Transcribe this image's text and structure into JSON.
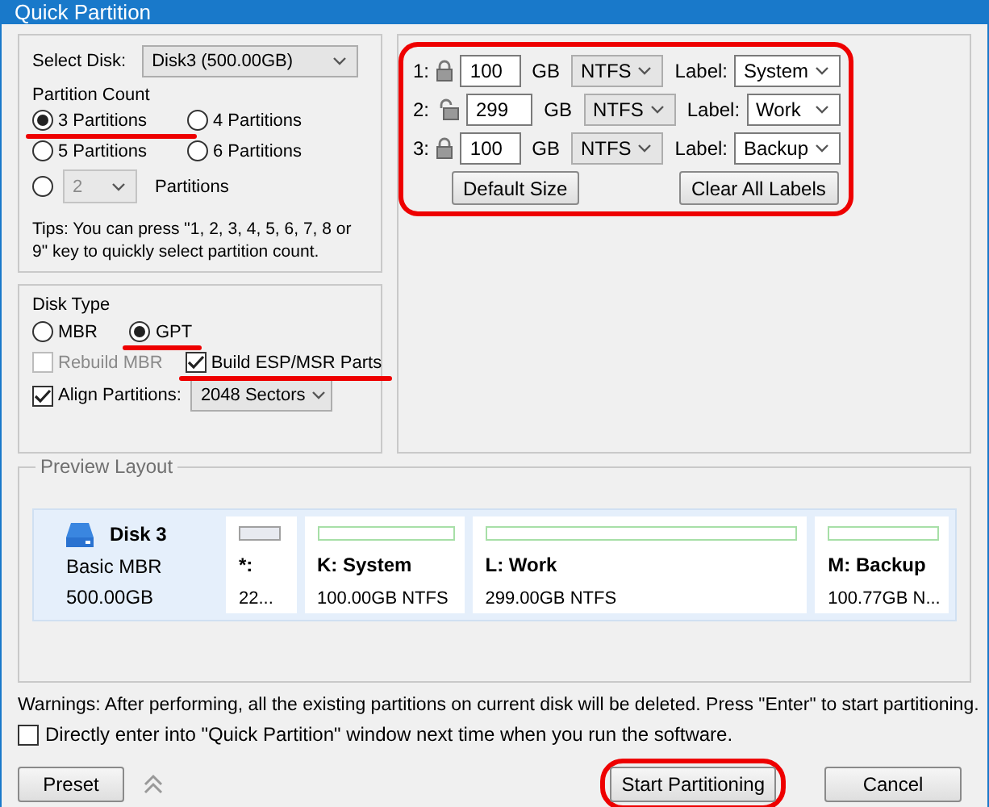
{
  "window": {
    "title": "Quick Partition"
  },
  "disk_select": {
    "label": "Select Disk:",
    "value": "Disk3 (500.00GB)"
  },
  "partition_count": {
    "title": "Partition Count",
    "options": [
      {
        "label": "3 Partitions",
        "selected": true,
        "marked": true
      },
      {
        "label": "4 Partitions",
        "selected": false,
        "marked": false
      },
      {
        "label": "5 Partitions",
        "selected": false,
        "marked": false
      },
      {
        "label": "6 Partitions",
        "selected": false,
        "marked": false
      }
    ],
    "custom": {
      "value": "2",
      "label": "Partitions",
      "selected": false,
      "disabled": true
    },
    "tips": "Tips: You can press \"1, 2, 3, 4, 5, 6, 7, 8 or 9\" key to quickly select partition count."
  },
  "disk_type": {
    "title": "Disk Type",
    "options": [
      {
        "label": "MBR",
        "selected": false,
        "marked": false
      },
      {
        "label": "GPT",
        "selected": true,
        "marked": true
      }
    ],
    "checkboxes": [
      {
        "label": "Rebuild MBR",
        "checked": false,
        "disabled": true,
        "marked": false
      },
      {
        "label": "Build ESP/MSR Parts",
        "checked": true,
        "disabled": false,
        "marked": true
      }
    ],
    "align": {
      "label": "Align Partitions:",
      "checked": true,
      "value": "2048 Sectors"
    }
  },
  "partitions": {
    "marked": true,
    "rows": [
      {
        "index": "1:",
        "locked": true,
        "size": "100",
        "unit": "GB",
        "fs": "NTFS",
        "label_caption": "Label:",
        "label": "System"
      },
      {
        "index": "2:",
        "locked": false,
        "size": "299",
        "unit": "GB",
        "fs": "NTFS",
        "label_caption": "Label:",
        "label": "Work"
      },
      {
        "index": "3:",
        "locked": true,
        "size": "100",
        "unit": "GB",
        "fs": "NTFS",
        "label_caption": "Label:",
        "label": "Backup"
      }
    ],
    "buttons": [
      "Default Size",
      "Clear All Labels"
    ]
  },
  "preview": {
    "title": "Preview Layout",
    "disk": {
      "name": "Disk 3",
      "type": "Basic MBR",
      "size": "500.00GB"
    },
    "parts": [
      {
        "kind": "unallocated",
        "name": "*:",
        "info": "22..."
      },
      {
        "kind": "ntfs",
        "name": "K: System",
        "info": "100.00GB NTFS"
      },
      {
        "kind": "ntfs",
        "name": "L: Work",
        "info": "299.00GB NTFS"
      },
      {
        "kind": "ntfs",
        "name": "M: Backup",
        "info": "100.77GB N..."
      }
    ]
  },
  "warning": "Warnings: After performing, all the existing partitions on current disk will be deleted. Press \"Enter\" to start partitioning.",
  "startup_checkbox": {
    "label": "Directly enter into \"Quick Partition\" window next time when you run the software.",
    "checked": false
  },
  "buttons": [
    {
      "kind": "preset",
      "label": "Preset",
      "marked": false
    },
    {
      "kind": "primary",
      "label": "Start Partitioning",
      "marked": true
    },
    {
      "kind": "cancel",
      "label": "Cancel",
      "marked": false
    }
  ]
}
